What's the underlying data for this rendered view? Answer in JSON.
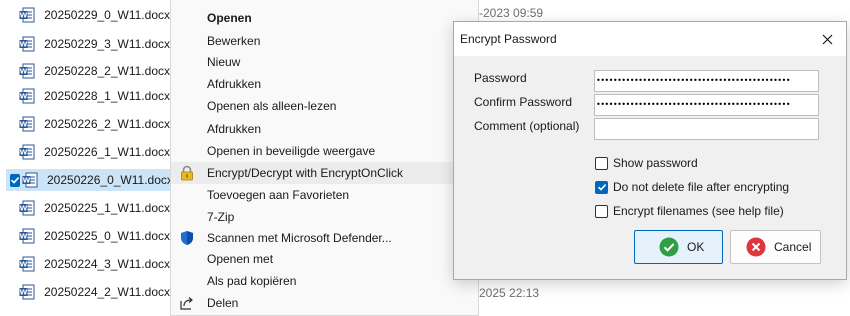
{
  "files": [
    {
      "name": "20250229_0_W11.docx",
      "selected": false
    },
    {
      "name": "20250229_3_W11.docx",
      "selected": false
    },
    {
      "name": "20250228_2_W11.docx",
      "selected": false
    },
    {
      "name": "20250228_1_W11.docx",
      "selected": false
    },
    {
      "name": "20250226_2_W11.docx",
      "selected": false
    },
    {
      "name": "20250226_1_W11.docx",
      "selected": false
    },
    {
      "name": "20250226_0_W11.docx",
      "selected": true
    },
    {
      "name": "20250225_1_W11.docx",
      "selected": false
    },
    {
      "name": "20250225_0_W11.docx",
      "selected": false
    },
    {
      "name": "20250224_3_W11.docx",
      "selected": false
    },
    {
      "name": "20250224_2_W11.docx",
      "selected": false
    }
  ],
  "background": {
    "date_top": "-2023 09:59",
    "date_bottom": "2025 22:13"
  },
  "context_menu": {
    "items": [
      {
        "label": "Openen",
        "bold": true,
        "icon": ""
      },
      {
        "label": "Bewerken",
        "bold": false,
        "icon": ""
      },
      {
        "label": "Nieuw",
        "bold": false,
        "icon": ""
      },
      {
        "label": "Afdrukken",
        "bold": false,
        "icon": ""
      },
      {
        "label": "Openen als alleen-lezen",
        "bold": false,
        "icon": ""
      },
      {
        "label": "Afdrukken",
        "bold": false,
        "icon": ""
      },
      {
        "label": "Openen in beveiligde weergave",
        "bold": false,
        "icon": ""
      },
      {
        "label": "Encrypt/Decrypt with EncryptOnClick",
        "bold": false,
        "icon": "padlock-icon",
        "hover": true
      },
      {
        "label": "Toevoegen aan Favorieten",
        "bold": false,
        "icon": ""
      },
      {
        "label": "7-Zip",
        "bold": false,
        "icon": ""
      },
      {
        "label": "Scannen met Microsoft Defender...",
        "bold": false,
        "icon": "defender-shield-icon"
      },
      {
        "label": "Openen met",
        "bold": false,
        "icon": ""
      },
      {
        "label": "Als pad kopiëren",
        "bold": false,
        "icon": ""
      },
      {
        "label": "Delen",
        "bold": false,
        "icon": "share-icon"
      }
    ]
  },
  "dialog": {
    "title": "Encrypt Password",
    "password_label": "Password",
    "password_value": "••••••••••••••••••••••••••••••••••••••••••••••",
    "confirm_label": "Confirm Password",
    "confirm_value": "••••••••••••••••••••••••••••••••••••••••••••••",
    "comment_label": "Comment (optional)",
    "comment_value": "",
    "show_password_label": "Show password",
    "show_password_checked": false,
    "no_delete_label": "Do not delete file after encrypting",
    "no_delete_checked": true,
    "encrypt_filenames_label": "Encrypt filenames (see help file)",
    "encrypt_filenames_checked": false,
    "ok_label": "OK",
    "cancel_label": "Cancel"
  },
  "colors": {
    "accent": "#0067c0",
    "selection": "#cce4f7",
    "ok_green": "#2ea043",
    "cancel_red": "#e0353b",
    "word_blue": "#2b579a"
  }
}
